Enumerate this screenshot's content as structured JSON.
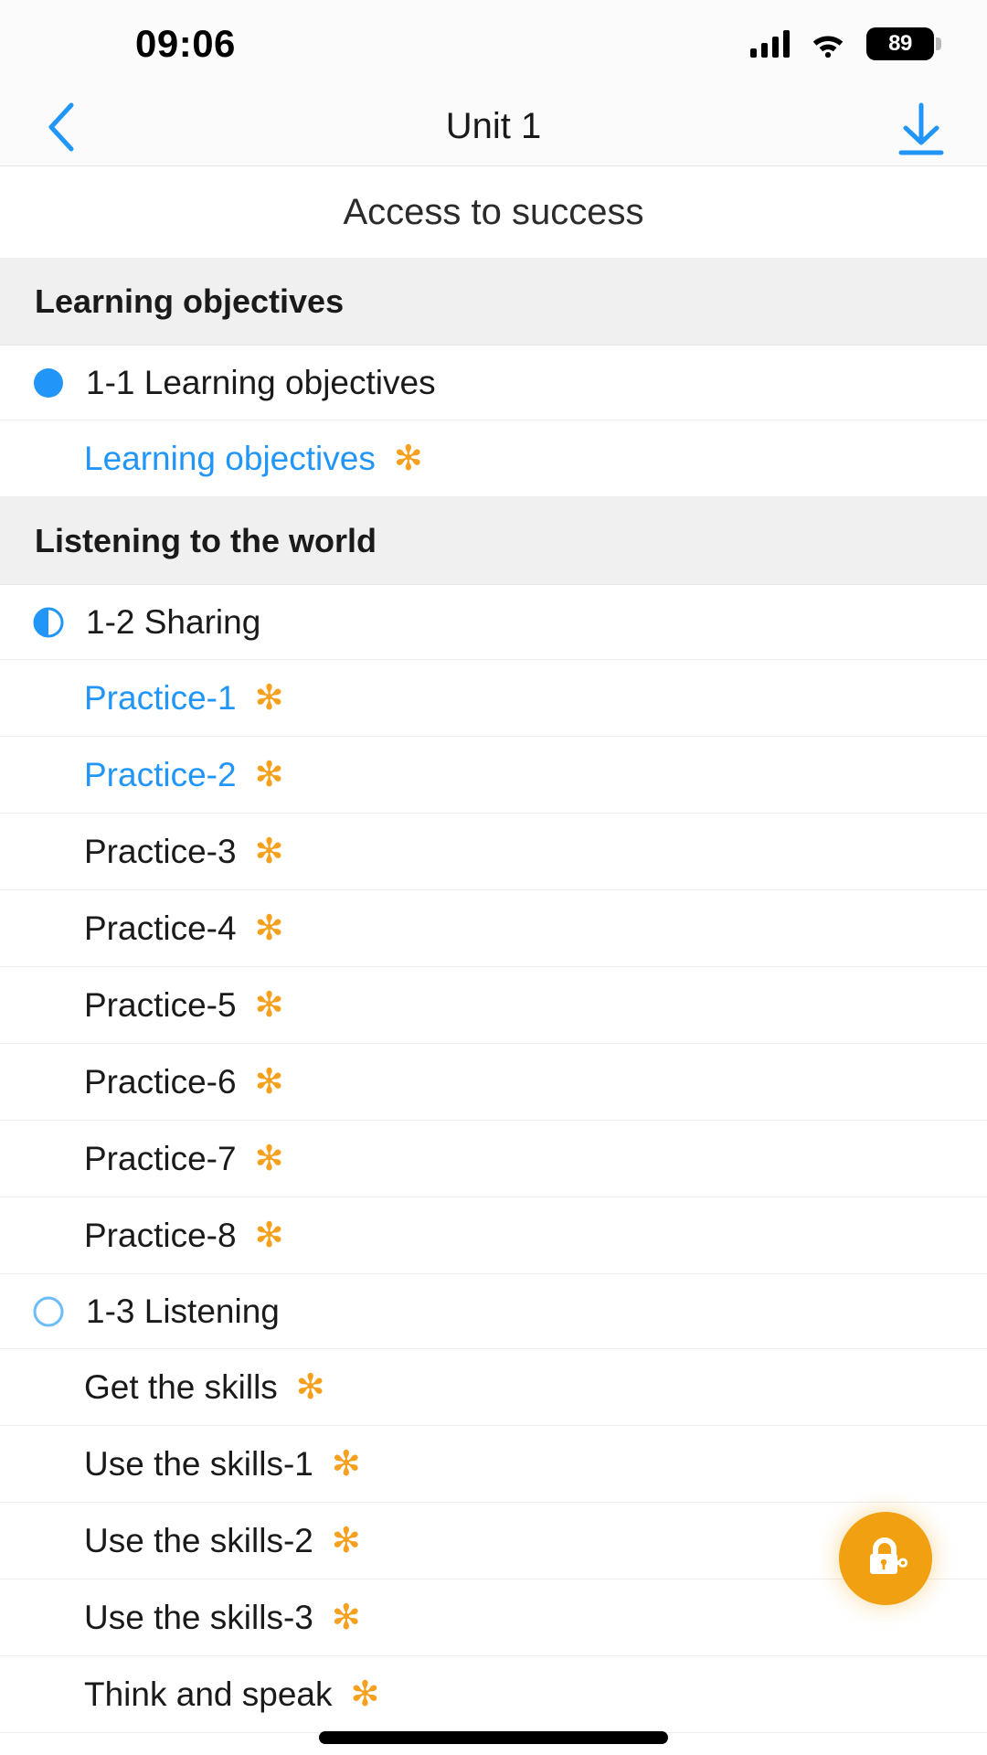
{
  "statusbar": {
    "time": "09:06",
    "battery_level": "89",
    "signal_icon": "cellular-signal-icon",
    "wifi_icon": "wifi-icon",
    "battery_icon": "battery-icon"
  },
  "navbar": {
    "back_icon": "chevron-left-icon",
    "title": "Unit 1",
    "download_icon": "download-arrow-icon"
  },
  "lesson": {
    "title": "Access to success"
  },
  "fab": {
    "icon": "lock-key-icon",
    "color": "#f0a010"
  },
  "colors": {
    "accent_blue": "#2196f8",
    "star_orange": "#f5a01e",
    "section_bg": "#f0f0f0"
  },
  "sections": [
    {
      "header": "Learning objectives",
      "chapters": [
        {
          "label": "1-1 Learning objectives",
          "status": "complete",
          "items": [
            {
              "label": "Learning objectives",
              "star": "✻",
              "visited": true
            }
          ]
        }
      ]
    },
    {
      "header": "Listening to the world",
      "chapters": [
        {
          "label": "1-2 Sharing",
          "status": "partial",
          "items": [
            {
              "label": "Practice-1",
              "star": "✻",
              "visited": true
            },
            {
              "label": "Practice-2",
              "star": "✻",
              "visited": true
            },
            {
              "label": "Practice-3",
              "star": "✻",
              "visited": false
            },
            {
              "label": "Practice-4",
              "star": "✻",
              "visited": false
            },
            {
              "label": "Practice-5",
              "star": "✻",
              "visited": false
            },
            {
              "label": "Practice-6",
              "star": "✻",
              "visited": false
            },
            {
              "label": "Practice-7",
              "star": "✻",
              "visited": false
            },
            {
              "label": "Practice-8",
              "star": "✻",
              "visited": false
            }
          ]
        },
        {
          "label": "1-3 Listening",
          "status": "empty",
          "items": [
            {
              "label": "Get the skills",
              "star": "✻",
              "visited": false
            },
            {
              "label": "Use the skills-1",
              "star": "✻",
              "visited": false
            },
            {
              "label": "Use the skills-2",
              "star": "✻",
              "visited": false
            },
            {
              "label": "Use the skills-3",
              "star": "✻",
              "visited": false
            },
            {
              "label": "Think and speak",
              "star": "✻",
              "visited": false
            }
          ]
        }
      ]
    }
  ]
}
